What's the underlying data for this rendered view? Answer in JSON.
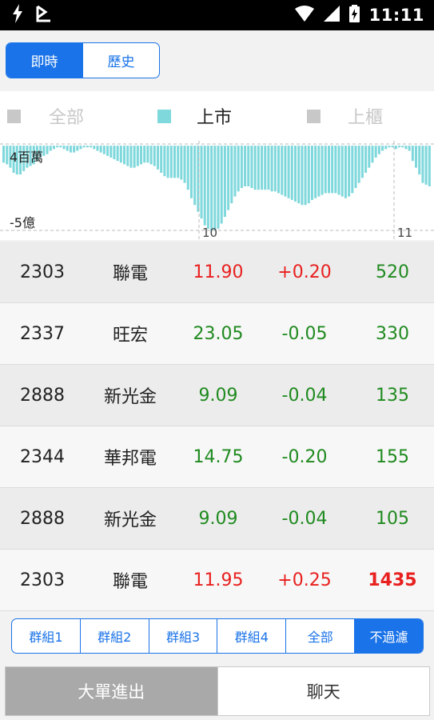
{
  "status_bar": {
    "time": "11:11"
  },
  "view_toggle": {
    "realtime": "即時",
    "history": "歷史"
  },
  "legend": {
    "items": [
      {
        "label": "全部",
        "color": "#c8c8c8",
        "text_color": "#c8c8c8"
      },
      {
        "label": "上市",
        "color": "#7fd8dc",
        "text_color": "#222222"
      },
      {
        "label": "上櫃",
        "color": "#c8c8c8",
        "text_color": "#c8c8c8"
      }
    ]
  },
  "chart_data": {
    "type": "bar",
    "series_color": "#7fd8dc",
    "y_top_label": "4百萬",
    "y_bottom_label": "-5億",
    "x_labels": [
      "10",
      "11"
    ],
    "values": [
      -1.0,
      -1.1,
      -1.3,
      -1.6,
      -1.7,
      -1.7,
      -1.5,
      -1.3,
      -1.2,
      -1.1,
      -0.9,
      -0.7,
      -0.6,
      -0.5,
      -0.3,
      -0.2,
      -0.1,
      -0.1,
      -0.2,
      -0.3,
      -0.4,
      -0.4,
      -0.3,
      -0.2,
      -0.1,
      -0.1,
      -0.1,
      -0.2,
      -0.3,
      -0.4,
      -0.5,
      -0.6,
      -0.7,
      -0.8,
      -0.9,
      -1.0,
      -1.1,
      -1.2,
      -1.3,
      -1.3,
      -1.2,
      -1.1,
      -1.0,
      -1.0,
      -1.1,
      -1.2,
      -1.4,
      -1.6,
      -1.8,
      -1.9,
      -1.9,
      -1.9,
      -1.9,
      -2.0,
      -2.2,
      -2.6,
      -3.1,
      -3.5,
      -3.9,
      -4.3,
      -4.7,
      -4.9,
      -5.0,
      -5.0,
      -4.9,
      -4.6,
      -4.2,
      -3.8,
      -3.4,
      -3.0,
      -2.7,
      -2.5,
      -2.4,
      -2.4,
      -2.5,
      -2.6,
      -2.6,
      -2.6,
      -2.6,
      -2.6,
      -2.7,
      -2.7,
      -2.8,
      -2.9,
      -3.0,
      -3.1,
      -3.2,
      -3.3,
      -3.4,
      -3.5,
      -3.5,
      -3.4,
      -3.2,
      -3.1,
      -3.0,
      -2.9,
      -2.8,
      -2.8,
      -2.8,
      -2.8,
      -2.9,
      -3.0,
      -3.1,
      -3.0,
      -2.8,
      -2.5,
      -2.2,
      -1.9,
      -1.6,
      -1.3,
      -1.0,
      -0.7,
      -0.5,
      -0.3,
      -0.2,
      -0.1,
      -0.1,
      -0.2,
      -0.1,
      -0.1,
      -0.2,
      -0.3,
      -0.9,
      -1.3,
      -1.7,
      -2.2,
      -2.3,
      -2.4
    ]
  },
  "stocks": [
    {
      "code": "2303",
      "name": "聯電",
      "price": "11.90",
      "change": "+0.20",
      "volume": "520",
      "price_color": "red",
      "change_color": "red",
      "volume_color": "green",
      "volume_bold": false
    },
    {
      "code": "2337",
      "name": "旺宏",
      "price": "23.05",
      "change": "-0.05",
      "volume": "330",
      "price_color": "green",
      "change_color": "green",
      "volume_color": "green",
      "volume_bold": false
    },
    {
      "code": "2888",
      "name": "新光金",
      "price": "9.09",
      "change": "-0.04",
      "volume": "135",
      "price_color": "green",
      "change_color": "green",
      "volume_color": "green",
      "volume_bold": false
    },
    {
      "code": "2344",
      "name": "華邦電",
      "price": "14.75",
      "change": "-0.20",
      "volume": "155",
      "price_color": "green",
      "change_color": "green",
      "volume_color": "green",
      "volume_bold": false
    },
    {
      "code": "2888",
      "name": "新光金",
      "price": "9.09",
      "change": "-0.04",
      "volume": "105",
      "price_color": "green",
      "change_color": "green",
      "volume_color": "green",
      "volume_bold": false
    },
    {
      "code": "2303",
      "name": "聯電",
      "price": "11.95",
      "change": "+0.25",
      "volume": "1435",
      "price_color": "red",
      "change_color": "red",
      "volume_color": "red",
      "volume_bold": true
    }
  ],
  "filters": {
    "items": [
      "群組1",
      "群組2",
      "群組3",
      "群組4",
      "全部",
      "不過濾"
    ],
    "active_index": 5
  },
  "bottom_tabs": {
    "big_orders": "大單進出",
    "chat": "聊天"
  }
}
